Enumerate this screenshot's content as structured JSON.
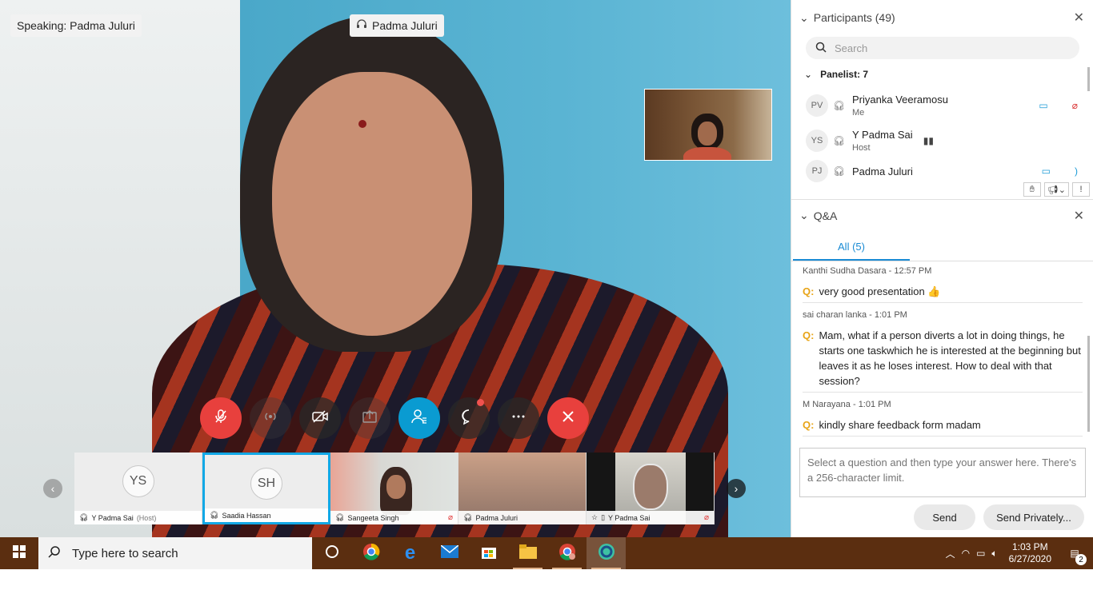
{
  "meeting": {
    "speaking_label": "Speaking: Padma Juluri",
    "video_name": "Padma Juluri"
  },
  "controls": [
    {
      "name": "mute-button",
      "icon": "microphone-muted-icon"
    },
    {
      "name": "audio-button",
      "icon": "audio-wave-icon"
    },
    {
      "name": "video-button",
      "icon": "video-off-icon"
    },
    {
      "name": "share-button",
      "icon": "share-icon"
    },
    {
      "name": "participants-button",
      "icon": "participants-icon"
    },
    {
      "name": "chat-button",
      "icon": "chat-bubble-icon"
    },
    {
      "name": "more-button",
      "icon": "more-icon"
    },
    {
      "name": "leave-button",
      "icon": "close-icon"
    }
  ],
  "filmstrip": [
    {
      "initials": "YS",
      "name": "Y Padma Sai",
      "suffix": "(Host)"
    },
    {
      "initials": "SH",
      "name": "Saadia Hassan"
    },
    {
      "name": "Sangeeta Singh"
    },
    {
      "name": "Padma Juluri"
    },
    {
      "name": "Y Padma Sai"
    }
  ],
  "participants": {
    "title": "Participants (49)",
    "search_placeholder": "Search",
    "panelist_label": "Panelist: 7",
    "rows": [
      {
        "initials": "PV",
        "name": "Priyanka Veeramosu",
        "role": "Me"
      },
      {
        "initials": "YS",
        "name": "Y Padma Sai",
        "role": "Host"
      },
      {
        "initials": "PJ",
        "name": "Padma Juluri",
        "role": ""
      }
    ]
  },
  "qa": {
    "title": "Q&A",
    "tab_all": "All (5)",
    "items": [
      {
        "meta": "Kanthi Sudha Dasara - 12:57 PM",
        "marker": "Q:",
        "text": "very good presentation 👍"
      },
      {
        "meta": "sai charan lanka - 1:01 PM",
        "marker": "Q:",
        "text": "Mam, what if a person diverts a lot in doing things, he starts one taskwhich he is interested at the beginning but leaves it as he loses interest. How to deal with that session?"
      },
      {
        "meta": "M Narayana - 1:01 PM",
        "marker": "Q:",
        "text": "kindly share feedback form madam"
      }
    ],
    "answer_placeholder": "Select a question and then type your answer here. There's a 256-character limit.",
    "send_label": "Send",
    "send_privately_label": "Send Privately..."
  },
  "taskbar": {
    "search_placeholder": "Type here to search",
    "time": "1:03 PM",
    "date": "6/27/2020",
    "notification_count": "2"
  },
  "colors": {
    "accent": "#0a9bd1",
    "leave_red": "#e8403d",
    "qa_marker": "#e8a417",
    "taskbar": "#5b2e10"
  }
}
